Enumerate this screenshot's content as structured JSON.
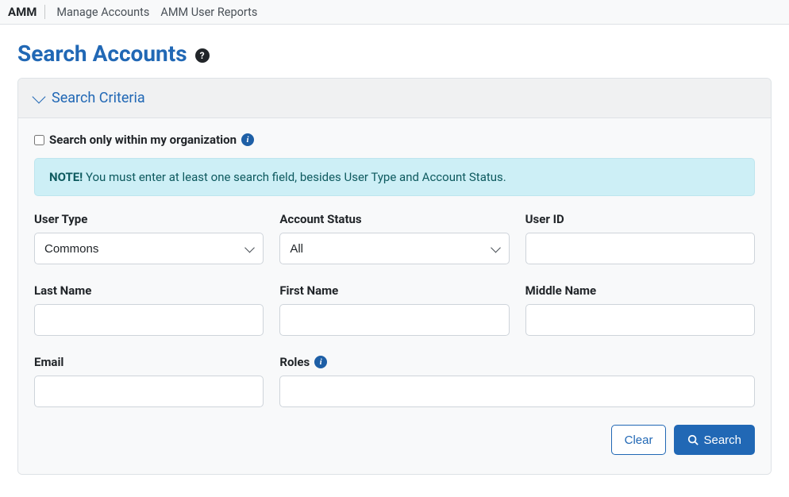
{
  "nav": {
    "brand": "AMM",
    "links": [
      "Manage Accounts",
      "AMM User Reports"
    ]
  },
  "page": {
    "title": "Search Accounts"
  },
  "panel": {
    "header": "Search Criteria",
    "checkbox_label": "Search only within my organization",
    "note_prefix": "NOTE!",
    "note_text": " You must enter at least one search field, besides User Type and Account Status."
  },
  "fields": {
    "user_type": {
      "label": "User Type",
      "value": "Commons"
    },
    "account_status": {
      "label": "Account Status",
      "value": "All"
    },
    "user_id": {
      "label": "User ID",
      "value": ""
    },
    "last_name": {
      "label": "Last Name",
      "value": ""
    },
    "first_name": {
      "label": "First Name",
      "value": ""
    },
    "middle_name": {
      "label": "Middle Name",
      "value": ""
    },
    "email": {
      "label": "Email",
      "value": ""
    },
    "roles": {
      "label": "Roles",
      "value": ""
    }
  },
  "buttons": {
    "clear": "Clear",
    "search": "Search"
  }
}
